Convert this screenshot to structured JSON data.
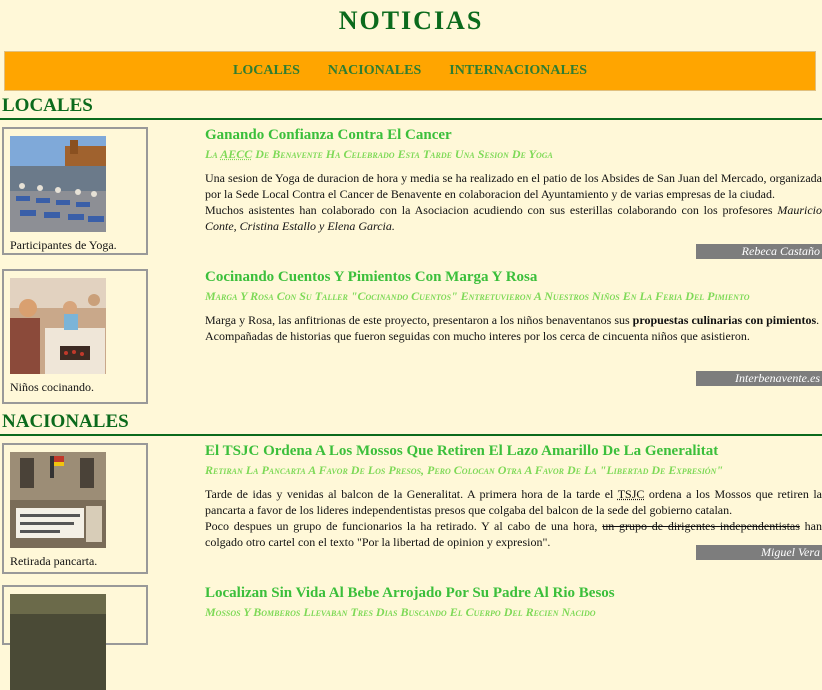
{
  "site": {
    "title": "NOTICIAS"
  },
  "nav": {
    "items": [
      "LOCALES",
      "NACIONALES",
      "INTERNACIONALES"
    ]
  },
  "sections": {
    "locales": "LOCALES",
    "nacionales": "NACIONALES"
  },
  "articles": [
    {
      "caption": "Participantes de Yoga.",
      "title": "Ganando Confianza Contra El Cancer",
      "subtitle_pre": "La ",
      "subtitle_abbr": "AECC",
      "subtitle_post": " De Benavente Ha Celebrado Esta Tarde Una Sesion De Yoga",
      "p1": "Una sesion de Yoga de duracion de hora y media se ha realizado en el patio de los Absides de San Juan del Mercado, organizada por la Sede Local Contra el Cancer de Benavente en colaboracion del Ayuntamiento y de varias empresas de la ciudad.",
      "p2_text": "Muchos asistentes han colaborado con la Asociacion acudiendo con sus esterillas colaborando con los profesores ",
      "p2_names": "Mauricio Conte, Cristina Estallo y Elena Garcia.",
      "author": "Rebeca Castaño"
    },
    {
      "caption": "Niños cocinando.",
      "title": "Cocinando Cuentos Y Pimientos Con Marga Y Rosa",
      "subtitle": "Marga Y Rosa Con Su Taller \"Cocinando Cuentos\" Entretuvieron A Nuestros Niños En La Feria Del Pimiento",
      "p1_text": "Marga y Rosa, las anfitrionas de este proyecto, presentaron a los niños benaventanos sus ",
      "p1_bold": "propuestas culinarias con pimientos",
      "p1_end": ".",
      "p2": "Acompañadas de historias que fueron seguidas con mucho interes por los cerca de cincuenta niños que asistieron.",
      "author": "Interbenavente.es"
    },
    {
      "caption": "Retirada pancarta.",
      "title": "El TSJC Ordena A Los Mossos Que Retiren El Lazo Amarillo De La Generalitat",
      "subtitle": "Retiran La Pancarta A Favor De Los Presos, Pero Colocan Otra A Favor De La \"Libertad De Expresión\"",
      "p1_pre": "Tarde de idas y venidas al balcon de la Generalitat. A primera hora de la tarde el ",
      "p1_abbr": "TSJC",
      "p1_post": " ordena a los Mossos que retiren la pancarta a favor de los lideres independentistas presos que colgaba del balcon de la sede del gobierno catalan.",
      "p2_pre": "Poco despues un grupo de funcionarios la ha retirado. Y al cabo de una hora, ",
      "p2_strike": "un grupo de dirigentes independentistas",
      "p2_post": " han colgado otro cartel con el texto \"Por la libertad de opinion y expresion\".",
      "author": "Miguel Vera"
    },
    {
      "title": "Localizan Sin Vida Al Bebe Arrojado Por Su Padre Al Rio Besos",
      "subtitle": "Mossos Y Bomberos Llevaban Tres Dias Buscando El Cuerpo Del Recien Nacido"
    }
  ],
  "colors": {
    "background": "#fff8d8",
    "nav_bg": "#ffa500",
    "heading_green": "#0b6a1c",
    "title_green": "#3bbf3b",
    "subtitle_green": "#7ed957",
    "author_bg": "#7d7d7d"
  }
}
